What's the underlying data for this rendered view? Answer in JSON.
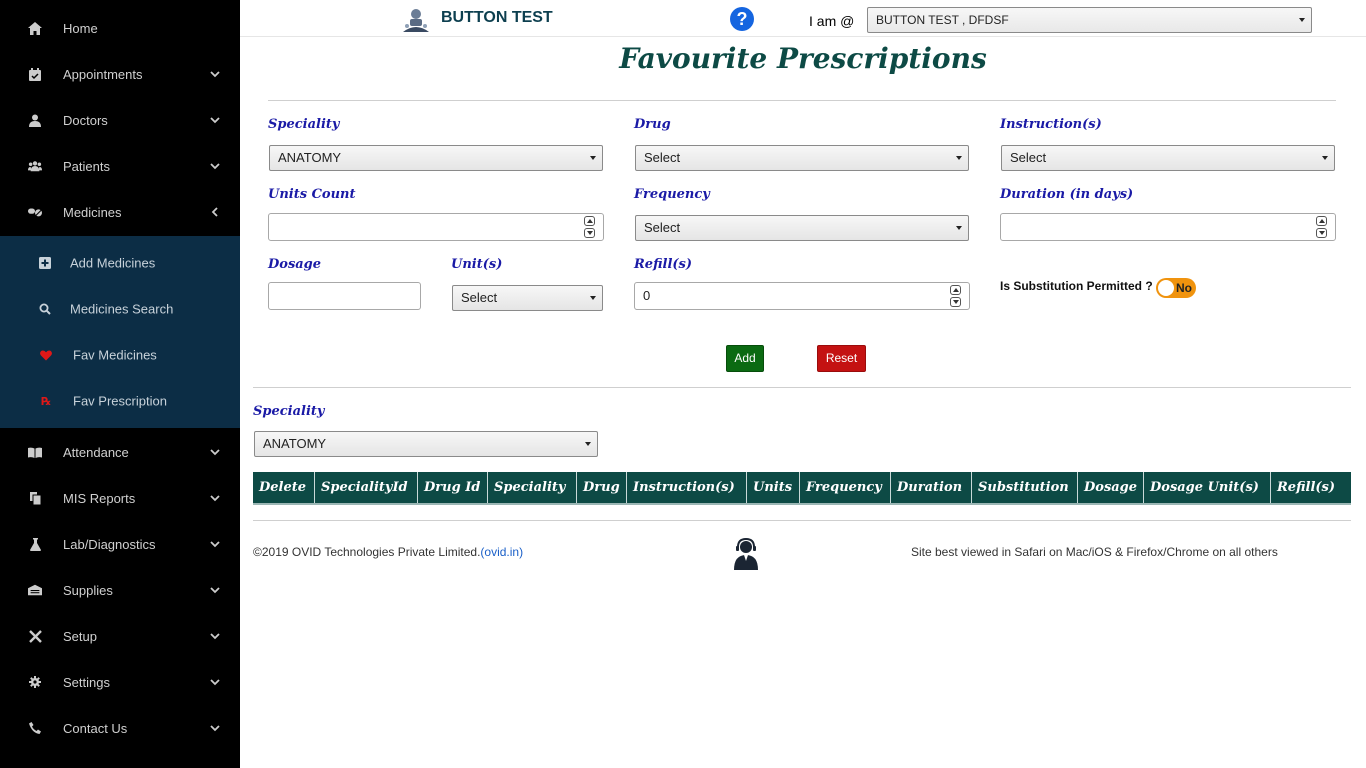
{
  "sidebar": {
    "items": [
      {
        "label": "Home",
        "icon": "home-icon"
      },
      {
        "label": "Appointments",
        "icon": "calendar-icon"
      },
      {
        "label": "Doctors",
        "icon": "doctor-icon"
      },
      {
        "label": "Patients",
        "icon": "users-icon"
      },
      {
        "label": "Medicines",
        "icon": "pills-icon"
      },
      {
        "label": "Attendance",
        "icon": "book-icon"
      },
      {
        "label": "MIS Reports",
        "icon": "copy-icon"
      },
      {
        "label": "Lab/Diagnostics",
        "icon": "flask-icon"
      },
      {
        "label": "Supplies",
        "icon": "warehouse-icon"
      },
      {
        "label": "Setup",
        "icon": "tools-icon"
      },
      {
        "label": "Settings",
        "icon": "gear-icon"
      },
      {
        "label": "Contact Us",
        "icon": "phone-icon"
      }
    ],
    "submenu": [
      {
        "label": "Add Medicines",
        "icon": "plus-square-icon"
      },
      {
        "label": "Medicines Search",
        "icon": "search-icon"
      },
      {
        "label": "Fav Medicines",
        "icon": "heart-icon"
      },
      {
        "label": "Fav Prescription",
        "icon": "prescription-icon"
      }
    ]
  },
  "header": {
    "app_title": "BUTTON TEST",
    "help": "?",
    "iam_label": "I am @",
    "iam_value": "BUTTON TEST , DFDSF"
  },
  "page_title": "Favourite Prescriptions",
  "form": {
    "speciality_label": "Speciality",
    "speciality_value": "ANATOMY",
    "drug_label": "Drug",
    "drug_value": "Select",
    "instruction_label": "Instruction(s)",
    "instruction_value": "Select",
    "units_count_label": "Units Count",
    "units_count_value": "",
    "frequency_label": "Frequency",
    "frequency_value": "Select",
    "duration_label": "Duration (in days)",
    "duration_value": "",
    "dosage_label": "Dosage",
    "dosage_value": "",
    "unit_label": "Unit(s)",
    "unit_value": "Select",
    "refill_label": "Refill(s)",
    "refill_value": "0",
    "substitution_label": "Is Substitution Permitted ?",
    "substitution_value": "No",
    "add_label": "Add",
    "reset_label": "Reset"
  },
  "filter": {
    "speciality_label": "Speciality",
    "speciality_value": "ANATOMY"
  },
  "table": {
    "columns": [
      "Delete",
      "SpecialityId",
      "Drug Id",
      "Speciality",
      "Drug",
      "Instruction(s)",
      "Units",
      "Frequency",
      "Duration",
      "Substitution",
      "Dosage",
      "Dosage Unit(s)",
      "Refill(s)"
    ]
  },
  "footer": {
    "copyright": "©2019 OVID Technologies Private Limited.",
    "link": "(ovid.in)",
    "browser_note": "Site best viewed in Safari on Mac/iOS & Firefox/Chrome on all others"
  },
  "colors": {
    "sidebar_bg": "#000000",
    "submenu_bg": "#0c2d45",
    "header_table": "#0d4a45",
    "label_blue": "#1a1aa6",
    "add_green": "#0b6a12",
    "reset_red": "#c41212",
    "toggle_orange": "#f0930e"
  }
}
